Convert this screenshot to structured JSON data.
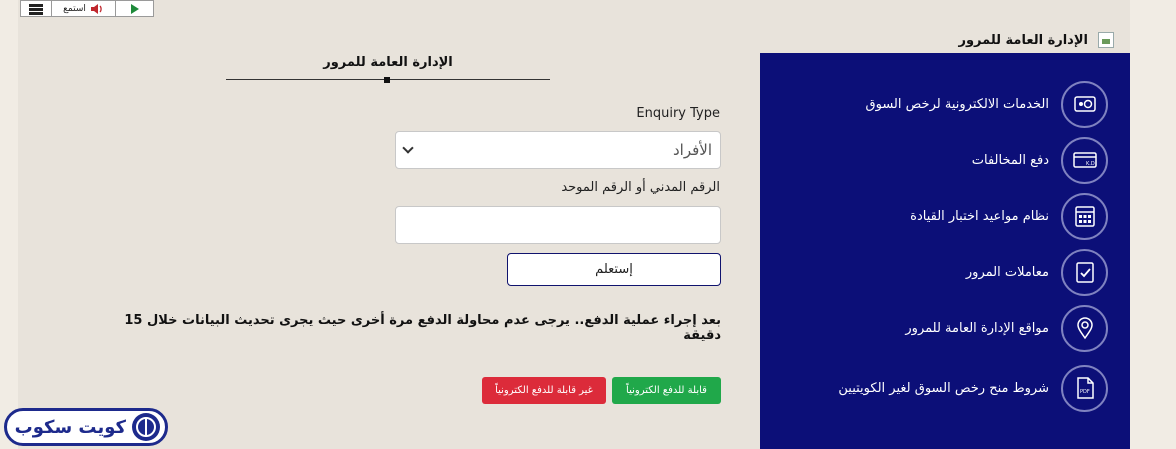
{
  "toolbar": {
    "listen_label": "استمع",
    "icons": [
      "menu-icon",
      "speaker-icon",
      "play-icon"
    ]
  },
  "header": {
    "site_title": "الإدارة العامة للمرور"
  },
  "form": {
    "title": "الإدارة العامة للمرور",
    "enquiry_type_label": "Enquiry Type",
    "enquiry_type_selected": "الأفراد",
    "civil_id_label": "الرقم المدني أو الرقم الموحد",
    "civil_id_value": "",
    "submit_label": "إستعلم",
    "note": "بعد إجراء عملية الدفع.. يرجى عدم محاولة الدفع مرة أخرى حيث يجرى تحديث البيانات خلال 15 دقيقة",
    "badge_payable": "قابلة للدفع الكترونياً",
    "badge_not_payable": "غير قابلة للدفع الكترونياً"
  },
  "sidebar": {
    "items": [
      {
        "label": "الخدمات الالكترونية لرخص السوق",
        "icon": "license-card-icon"
      },
      {
        "label": "دفع المخالفات",
        "icon": "payment-card-icon"
      },
      {
        "label": "نظام مواعيد اختبار القيادة",
        "icon": "calendar-icon"
      },
      {
        "label": "معاملات المرور",
        "icon": "document-check-icon"
      },
      {
        "label": "مواقع الإدارة العامة للمرور",
        "icon": "location-pin-icon"
      },
      {
        "label": "شروط منح رخص السوق لغير الكويتيين",
        "icon": "pdf-document-icon"
      }
    ]
  },
  "watermark": {
    "logo_text": "كويت سكوب"
  },
  "colors": {
    "panel": "#0c0f78",
    "accent_green": "#20a84a",
    "accent_red": "#dc2b3a",
    "button_border": "#10136e"
  }
}
